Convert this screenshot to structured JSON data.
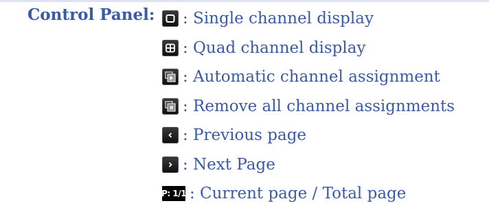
{
  "heading": "Control Panel:",
  "items": [
    {
      "icon": "single-channel-icon",
      "label": ": Single channel display"
    },
    {
      "icon": "quad-channel-icon",
      "label": ": Quad channel display"
    },
    {
      "icon": "auto-assign-icon",
      "label": ": Automatic channel assignment"
    },
    {
      "icon": "remove-assign-icon",
      "label": ": Remove all channel assignments"
    },
    {
      "icon": "chevron-left-icon",
      "label": ": Previous page"
    },
    {
      "icon": "chevron-right-icon",
      "label": ": Next Page"
    },
    {
      "icon": "page-indicator-icon",
      "icon_text": "P: 1/1",
      "label": ": Current page / Total page"
    }
  ],
  "colors": {
    "text": "#3b5aa6",
    "icon_bg": "#1a1a1a",
    "icon_fg": "#ffffff"
  }
}
